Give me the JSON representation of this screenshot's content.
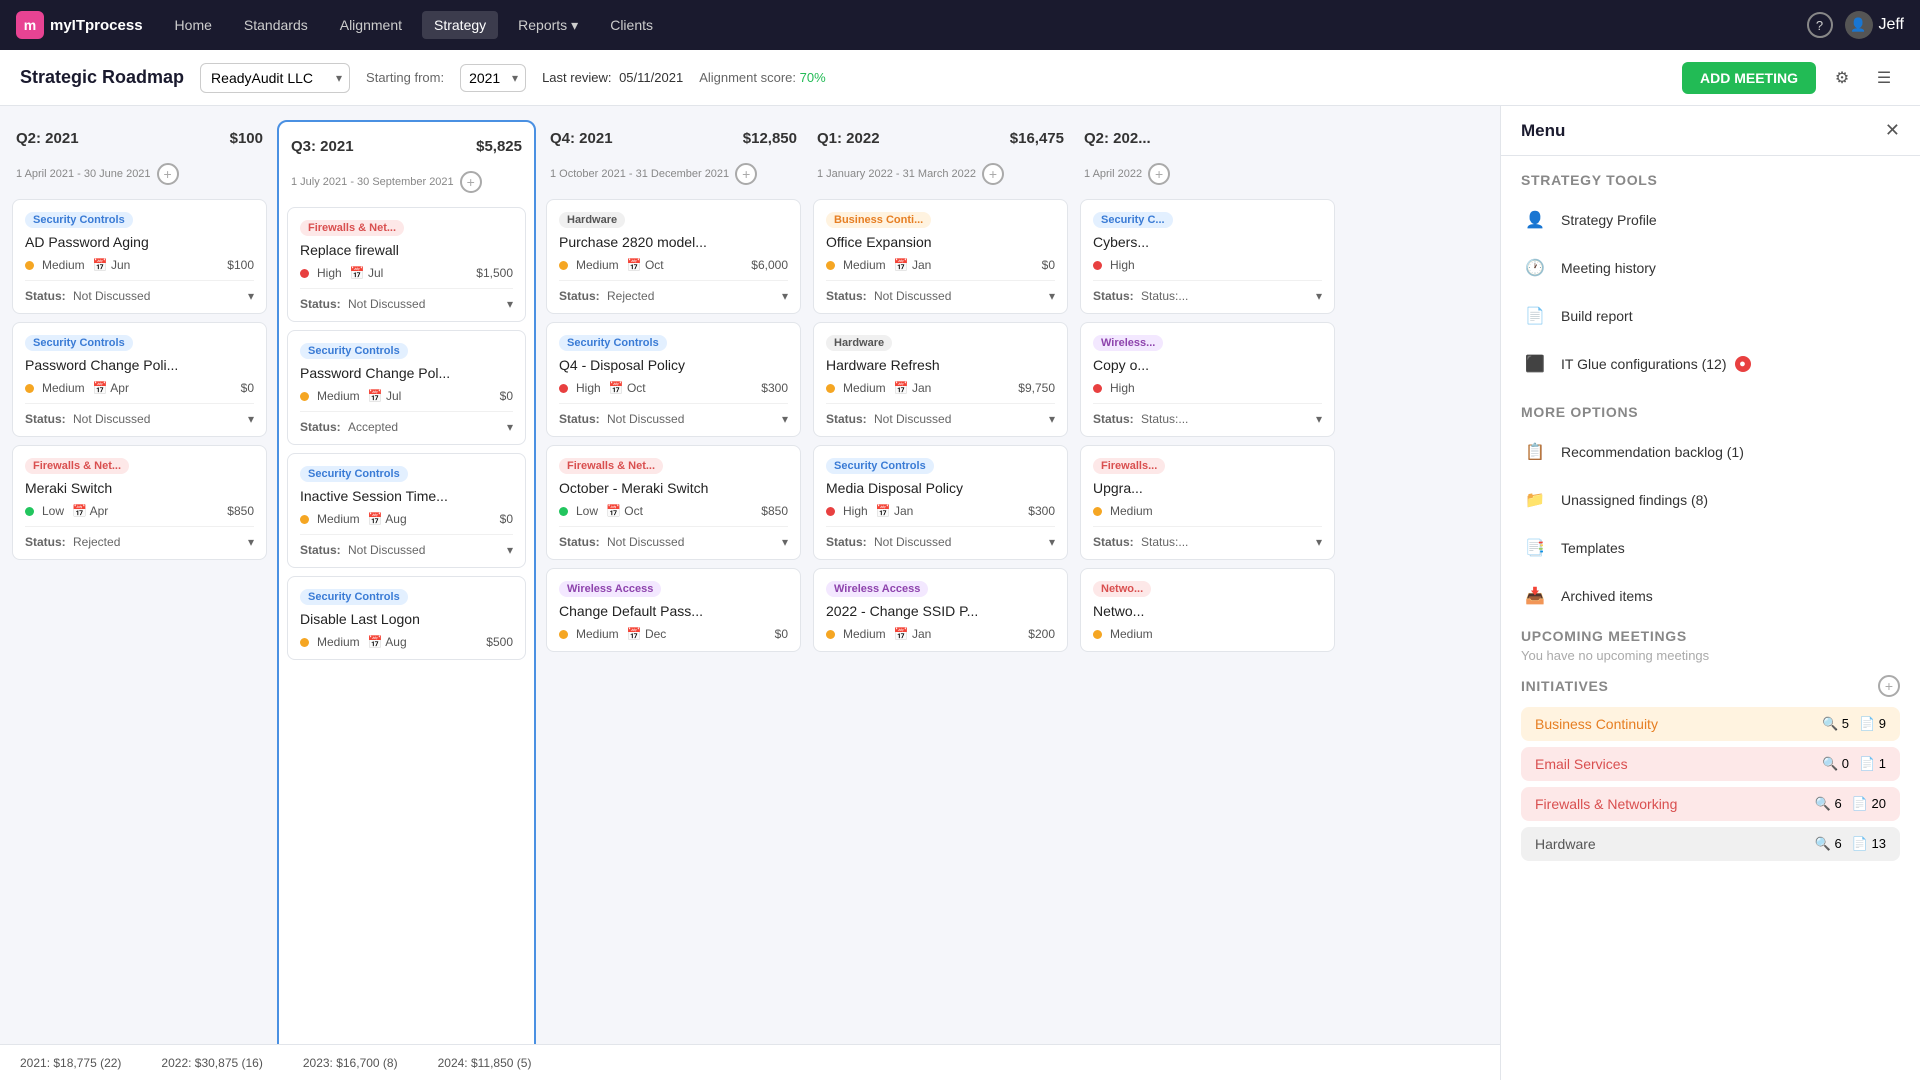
{
  "nav": {
    "logo_letter": "m",
    "logo_text": "myITprocess",
    "items": [
      {
        "label": "Home",
        "active": false
      },
      {
        "label": "Standards",
        "active": false
      },
      {
        "label": "Alignment",
        "active": false
      },
      {
        "label": "Strategy",
        "active": true
      },
      {
        "label": "Reports",
        "active": false,
        "has_arrow": true
      },
      {
        "label": "Clients",
        "active": false
      }
    ],
    "user_name": "Jeff"
  },
  "toolbar": {
    "page_title": "Strategic Roadmap",
    "company": "ReadyAudit LLC",
    "starting_from_label": "Starting from:",
    "year": "2021",
    "last_review_label": "Last review:",
    "last_review_date": "05/11/2021",
    "alignment_score_label": "Alignment score:",
    "alignment_score_value": "70%",
    "add_meeting_label": "ADD MEETING"
  },
  "columns": [
    {
      "id": "q2-2021",
      "title": "Q2: 2021",
      "amount": "$100",
      "date_range": "1 April 2021 - 30 June 2021",
      "highlighted": false,
      "cards": [
        {
          "category": "Security Controls",
          "cat_class": "cat-security",
          "title": "AD Password Aging",
          "priority": "Medium",
          "priority_class": "dot-medium",
          "date": "Jun",
          "amount": "$100",
          "status": "Not Discussed"
        },
        {
          "category": "Security Controls",
          "cat_class": "cat-security",
          "title": "Password Change Poli...",
          "priority": "Medium",
          "priority_class": "dot-medium",
          "date": "Apr",
          "amount": "$0",
          "status": "Not Discussed"
        },
        {
          "category": "Firewalls & Net...",
          "cat_class": "cat-firewalls",
          "title": "Meraki Switch",
          "priority": "Low",
          "priority_class": "dot-low",
          "date": "Apr",
          "amount": "$850",
          "status": "Rejected"
        }
      ]
    },
    {
      "id": "q3-2021",
      "title": "Q3: 2021",
      "amount": "$5,825",
      "date_range": "1 July 2021 - 30 September 2021",
      "highlighted": true,
      "cards": [
        {
          "category": "Firewalls & Net...",
          "cat_class": "cat-firewalls",
          "title": "Replace firewall",
          "priority": "High",
          "priority_class": "dot-high",
          "date": "Jul",
          "amount": "$1,500",
          "status": "Not Discussed"
        },
        {
          "category": "Security Controls",
          "cat_class": "cat-security",
          "title": "Password Change Pol...",
          "priority": "Medium",
          "priority_class": "dot-medium",
          "date": "Jul",
          "amount": "$0",
          "status": "Accepted"
        },
        {
          "category": "Security Controls",
          "cat_class": "cat-security",
          "title": "Inactive Session Time...",
          "priority": "Medium",
          "priority_class": "dot-medium",
          "date": "Aug",
          "amount": "$0",
          "status": "Not Discussed"
        },
        {
          "category": "Security Controls",
          "cat_class": "cat-security",
          "title": "Disable Last Logon",
          "priority": "Medium",
          "priority_class": "dot-medium",
          "date": "Aug",
          "amount": "$500",
          "status": ""
        }
      ]
    },
    {
      "id": "q4-2021",
      "title": "Q4: 2021",
      "amount": "$12,850",
      "date_range": "1 October 2021 - 31 December 2021",
      "highlighted": false,
      "cards": [
        {
          "category": "Hardware",
          "cat_class": "cat-hardware",
          "title": "Purchase 2820 model...",
          "priority": "Medium",
          "priority_class": "dot-medium",
          "date": "Oct",
          "amount": "$6,000",
          "status": "Rejected"
        },
        {
          "category": "Security Controls",
          "cat_class": "cat-security",
          "title": "Q4 - Disposal Policy",
          "priority": "High",
          "priority_class": "dot-high",
          "date": "Oct",
          "amount": "$300",
          "status": "Not Discussed"
        },
        {
          "category": "Firewalls & Net...",
          "cat_class": "cat-firewalls",
          "title": "October - Meraki Switch",
          "priority": "Low",
          "priority_class": "dot-low",
          "date": "Oct",
          "amount": "$850",
          "status": "Not Discussed"
        },
        {
          "category": "Wireless Access",
          "cat_class": "cat-wireless",
          "title": "Change Default Pass...",
          "priority": "Medium",
          "priority_class": "dot-medium",
          "date": "Dec",
          "amount": "$0",
          "status": ""
        }
      ]
    },
    {
      "id": "q1-2022",
      "title": "Q1: 2022",
      "amount": "$16,475",
      "date_range": "1 January 2022 - 31 March 2022",
      "highlighted": false,
      "cards": [
        {
          "category": "Business Conti...",
          "cat_class": "cat-business",
          "title": "Office Expansion",
          "priority": "Medium",
          "priority_class": "dot-medium",
          "date": "Jan",
          "amount": "$0",
          "status": "Not Discussed"
        },
        {
          "category": "Hardware",
          "cat_class": "cat-hardware",
          "title": "Hardware Refresh",
          "priority": "Medium",
          "priority_class": "dot-medium",
          "date": "Jan",
          "amount": "$9,750",
          "status": "Not Discussed"
        },
        {
          "category": "Security Controls",
          "cat_class": "cat-security",
          "title": "Media Disposal Policy",
          "priority": "High",
          "priority_class": "dot-high",
          "date": "Jan",
          "amount": "$300",
          "status": "Not Discussed"
        },
        {
          "category": "Wireless Access",
          "cat_class": "cat-wireless",
          "title": "2022 - Change SSID P...",
          "priority": "Medium",
          "priority_class": "dot-medium",
          "date": "Jan",
          "amount": "$200",
          "status": ""
        }
      ]
    },
    {
      "id": "q2-2022",
      "title": "Q2: 202...",
      "amount": "",
      "date_range": "1 April 2022",
      "highlighted": false,
      "cards": [
        {
          "category": "Security C...",
          "cat_class": "cat-security",
          "title": "Cybers...",
          "priority": "High",
          "priority_class": "dot-high",
          "date": "",
          "amount": "",
          "status": "Status:..."
        },
        {
          "category": "Wireless...",
          "cat_class": "cat-wireless",
          "title": "Copy o...",
          "priority": "High",
          "priority_class": "dot-high",
          "date": "",
          "amount": "",
          "status": "Status:..."
        },
        {
          "category": "Firewalls...",
          "cat_class": "cat-firewalls",
          "title": "Upgra...",
          "priority": "Medium",
          "priority_class": "dot-medium",
          "date": "",
          "amount": "",
          "status": "Status:..."
        },
        {
          "category": "Netwo...",
          "cat_class": "cat-firewalls",
          "title": "Netwo...",
          "priority": "Medium",
          "priority_class": "dot-medium",
          "date": "",
          "amount": "",
          "status": ""
        }
      ]
    }
  ],
  "footer": {
    "items": [
      {
        "label": "2021: $18,775 (22)"
      },
      {
        "label": "2022: $30,875 (16)"
      },
      {
        "label": "2023: $16,700 (8)"
      },
      {
        "label": "2024: $11,850 (5)"
      }
    ]
  },
  "sidebar": {
    "title": "Menu",
    "strategy_tools_label": "Strategy Tools",
    "tools": [
      {
        "icon": "👤",
        "label": "Strategy Profile"
      },
      {
        "icon": "🕐",
        "label": "Meeting history"
      },
      {
        "icon": "📄",
        "label": "Build report"
      },
      {
        "icon": "⬛",
        "label": "IT Glue configurations (12)",
        "has_badge": true
      }
    ],
    "more_options_label": "More options",
    "more_options": [
      {
        "icon": "📋",
        "label": "Recommendation backlog (1)"
      },
      {
        "icon": "📁",
        "label": "Unassigned findings (8)"
      },
      {
        "icon": "📑",
        "label": "Templates"
      },
      {
        "icon": "📥",
        "label": "Archived items"
      }
    ],
    "upcoming_label": "Upcoming meetings",
    "upcoming_empty": "You have no upcoming meetings",
    "initiatives_label": "Initiatives",
    "initiatives": [
      {
        "name": "Business Continuity",
        "color_class": "init-bc",
        "users": "5",
        "files": "9"
      },
      {
        "name": "Email Services",
        "color_class": "init-email",
        "users": "0",
        "files": "1"
      },
      {
        "name": "Firewalls & Networking",
        "color_class": "init-fw",
        "users": "6",
        "files": "20"
      },
      {
        "name": "Hardware",
        "color_class": "init-hw",
        "users": "6",
        "files": "13"
      }
    ]
  }
}
